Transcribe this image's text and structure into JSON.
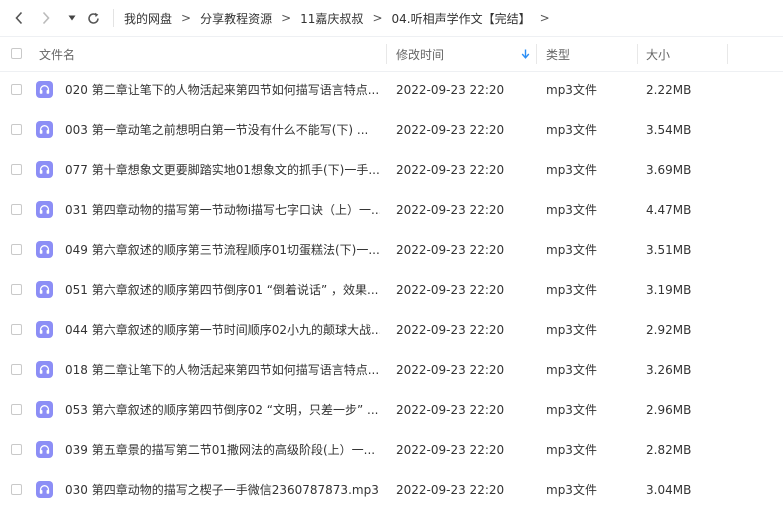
{
  "breadcrumb": [
    "我的网盘",
    "分享教程资源",
    "11嘉庆叔叔",
    "04.听相声学作文【完结】"
  ],
  "breadcrumb_separator": ">",
  "columns": {
    "name": "文件名",
    "modified": "修改时间",
    "type": "类型",
    "size": "大小"
  },
  "sort": {
    "column": "modified",
    "direction": "descending"
  },
  "accent_color": "#2a8ef5",
  "file_icon": {
    "name": "audio-headphones-icon",
    "color": "#8c8ef6"
  },
  "files": [
    {
      "name": "020 第二章让笔下的人物活起来第四节如何描写语言特点...",
      "modified": "2022-09-23 22:20",
      "type": "mp3文件",
      "size": "2.22MB"
    },
    {
      "name": "003 第一章动笔之前想明白第一节没有什么不能写(下) ...",
      "modified": "2022-09-23 22:20",
      "type": "mp3文件",
      "size": "3.54MB"
    },
    {
      "name": "077 第十章想象文更要脚踏实地01想象文的抓手(下)一手...",
      "modified": "2022-09-23 22:20",
      "type": "mp3文件",
      "size": "3.69MB"
    },
    {
      "name": "031 第四章动物的描写第一节动物i描写七字口诀（上）一...",
      "modified": "2022-09-23 22:20",
      "type": "mp3文件",
      "size": "4.47MB"
    },
    {
      "name": "049 第六章叙述的顺序第三节流程顺序01切蛋糕法(下)一...",
      "modified": "2022-09-23 22:20",
      "type": "mp3文件",
      "size": "3.51MB"
    },
    {
      "name": "051 第六章叙述的顺序第四节倒序01 “倒着说话” ，效果...",
      "modified": "2022-09-23 22:20",
      "type": "mp3文件",
      "size": "3.19MB"
    },
    {
      "name": "044 第六章叙述的顺序第一节时间顺序02小九的颠球大战...",
      "modified": "2022-09-23 22:20",
      "type": "mp3文件",
      "size": "2.92MB"
    },
    {
      "name": "018 第二章让笔下的人物活起来第四节如何描写语言特点...",
      "modified": "2022-09-23 22:20",
      "type": "mp3文件",
      "size": "3.26MB"
    },
    {
      "name": "053 第六章叙述的顺序第四节倒序02 “文明，只差一步” ...",
      "modified": "2022-09-23 22:20",
      "type": "mp3文件",
      "size": "2.96MB"
    },
    {
      "name": "039 第五章景的描写第二节01撒网法的高级阶段(上）一...",
      "modified": "2022-09-23 22:20",
      "type": "mp3文件",
      "size": "2.82MB"
    },
    {
      "name": "030 第四章动物的描写之楔子一手微信2360787873.mp3",
      "modified": "2022-09-23 22:20",
      "type": "mp3文件",
      "size": "3.04MB"
    }
  ]
}
